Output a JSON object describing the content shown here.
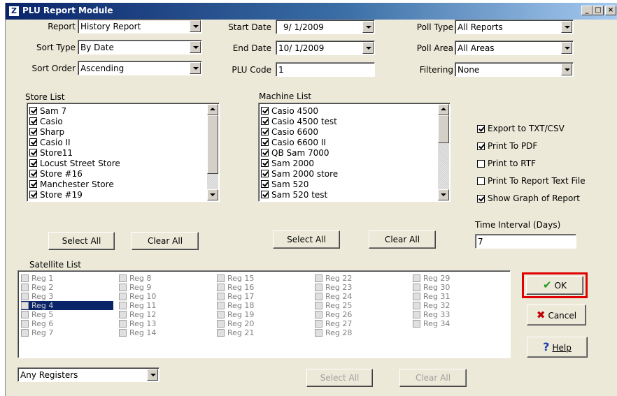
{
  "window": {
    "title": "PLU Report Module",
    "icon": "Z"
  },
  "controls": {
    "report": {
      "label": "Report",
      "value": "History Report"
    },
    "sort_type": {
      "label": "Sort Type",
      "value": "By Date"
    },
    "sort_order": {
      "label": "Sort Order",
      "value": "Ascending"
    },
    "start_date": {
      "label": "Start Date",
      "value": "9/ 1/2009"
    },
    "end_date": {
      "label": "End Date",
      "value": "10/ 1/2009"
    },
    "plu_code": {
      "label": "PLU Code",
      "value": "1"
    },
    "poll_type": {
      "label": "Poll Type",
      "value": "All Reports"
    },
    "poll_area": {
      "label": "Poll Area",
      "value": "All Areas"
    },
    "filtering": {
      "label": "Filtering",
      "value": "None"
    }
  },
  "store_list": {
    "title": "Store List",
    "items": [
      {
        "label": "Sam 7",
        "checked": true
      },
      {
        "label": "Casio",
        "checked": true
      },
      {
        "label": "Sharp",
        "checked": true
      },
      {
        "label": "Casio II",
        "checked": true
      },
      {
        "label": "Store11",
        "checked": true
      },
      {
        "label": "Locust Street Store",
        "checked": true
      },
      {
        "label": "Store #16",
        "checked": true
      },
      {
        "label": "Manchester Store",
        "checked": true
      },
      {
        "label": "Store #19",
        "checked": true
      }
    ],
    "select_all": "Select All",
    "clear_all": "Clear All"
  },
  "machine_list": {
    "title": "Machine List",
    "items": [
      {
        "label": "Casio 4500",
        "checked": true
      },
      {
        "label": "Casio 4500 test",
        "checked": true
      },
      {
        "label": "Casio 6600",
        "checked": true
      },
      {
        "label": "Casio 6600 II",
        "checked": true
      },
      {
        "label": "QB Sam 7000",
        "checked": true
      },
      {
        "label": "Sam 2000",
        "checked": true
      },
      {
        "label": "Sam 2000 store",
        "checked": true
      },
      {
        "label": "Sam 520",
        "checked": true
      },
      {
        "label": "Sam 520 test",
        "checked": true
      }
    ],
    "select_all": "Select All",
    "clear_all": "Clear All"
  },
  "options": [
    {
      "label": "Export to TXT/CSV",
      "checked": true
    },
    {
      "label": "Print To PDF",
      "checked": true
    },
    {
      "label": "Print to RTF",
      "checked": false
    },
    {
      "label": "Print To Report Text File",
      "checked": false
    },
    {
      "label": "Show Graph of Report",
      "checked": true
    }
  ],
  "time_interval": {
    "label": "Time Interval (Days)",
    "value": "7"
  },
  "satellite_list": {
    "title": "Satellite List",
    "items": [
      "Reg 1",
      "Reg 2",
      "Reg 3",
      "Reg 4",
      "Reg 5",
      "Reg 6",
      "Reg 7",
      "Reg 8",
      "Reg 9",
      "Reg 10",
      "Reg 11",
      "Reg 12",
      "Reg 13",
      "Reg 14",
      "Reg 15",
      "Reg 16",
      "Reg 17",
      "Reg 18",
      "Reg 19",
      "Reg 20",
      "Reg 21",
      "Reg 22",
      "Reg 23",
      "Reg 24",
      "Reg 25",
      "Reg 26",
      "Reg 27",
      "Reg 28",
      "Reg 29",
      "Reg 30",
      "Reg 31",
      "Reg 32",
      "Reg 33",
      "Reg 34"
    ],
    "selected": "Reg 4",
    "registers_filter": "Any Registers",
    "select_all": "Select All",
    "clear_all": "Clear All"
  },
  "buttons": {
    "ok": "OK",
    "cancel": "Cancel",
    "help": "Help"
  },
  "colors": {
    "highlight_frame": "#e00000",
    "title_bar": "#0a246a",
    "ok_check": "#1e9b1e",
    "cancel_x": "#c00000",
    "help_icon": "#1a3fb0"
  }
}
